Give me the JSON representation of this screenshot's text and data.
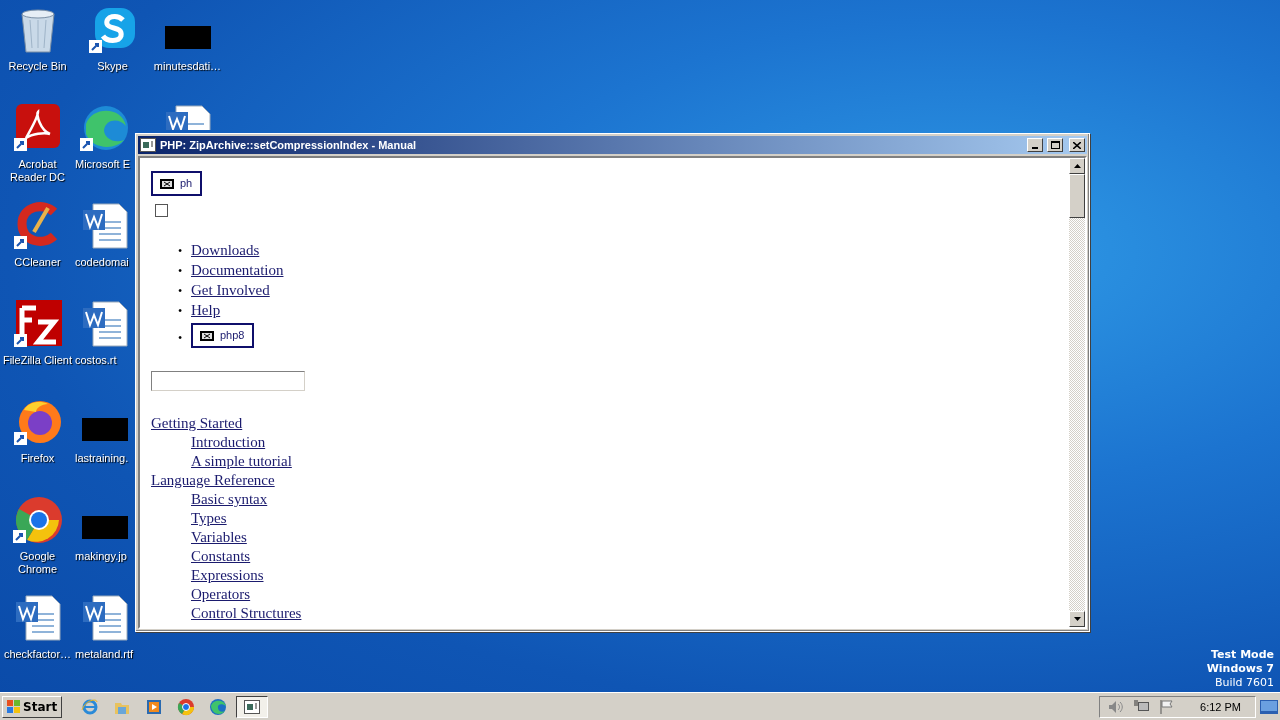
{
  "desktop": {
    "columns": [
      [
        {
          "kind": "recycle",
          "label": "Recycle Bin"
        },
        {
          "kind": "acrobat",
          "label": "Acrobat Reader DC"
        },
        {
          "kind": "ccleaner",
          "label": "CCleaner"
        },
        {
          "kind": "filezilla",
          "label": "FileZilla Client"
        },
        {
          "kind": "firefox",
          "label": "Firefox"
        },
        {
          "kind": "chrome",
          "label": "Google Chrome"
        },
        {
          "kind": "word",
          "label": "checkfactor…"
        }
      ],
      [
        {
          "kind": "skype",
          "label": "Skype"
        },
        {
          "kind": "edge",
          "label": "Microsoft E"
        },
        {
          "kind": "word",
          "label": "codedomai"
        },
        {
          "kind": "word",
          "label": "costos.rt"
        },
        {
          "kind": "redacted",
          "label": "lastraining."
        },
        {
          "kind": "redacted",
          "label": "makingy.jp"
        },
        {
          "kind": "word",
          "label": "metaland.rtf"
        }
      ],
      [
        {
          "kind": "redacted",
          "label": "minutesdati…"
        },
        {
          "kind": "word"
        }
      ]
    ]
  },
  "window": {
    "title": "PHP: ZipArchive::setCompressionIndex - Manual",
    "logo_alt": "ph",
    "checkbox": {
      "checked": false
    },
    "menu_bullet": "•",
    "menu": [
      {
        "kind": "link",
        "label": "Downloads"
      },
      {
        "kind": "link",
        "label": "Documentation"
      },
      {
        "kind": "link",
        "label": "Get Involved"
      },
      {
        "kind": "link",
        "label": "Help"
      },
      {
        "kind": "image",
        "alt": "php8"
      }
    ],
    "nav": [
      {
        "label": "Getting Started",
        "children": [
          {
            "label": "Introduction"
          },
          {
            "label": "A simple tutorial"
          }
        ]
      },
      {
        "label": "Language Reference",
        "children": [
          {
            "label": "Basic syntax"
          },
          {
            "label": "Types"
          },
          {
            "label": "Variables"
          },
          {
            "label": "Constants"
          },
          {
            "label": "Expressions"
          },
          {
            "label": "Operators"
          },
          {
            "label": "Control Structures"
          }
        ]
      }
    ]
  },
  "watermark": [
    "Test Mode",
    "Windows 7",
    "Build 7601"
  ],
  "taskbar": {
    "start": "Start",
    "items": [
      {
        "kind": "ie",
        "selected": false
      },
      {
        "kind": "explorer",
        "selected": false
      },
      {
        "kind": "media",
        "selected": false
      },
      {
        "kind": "chrome",
        "selected": false
      },
      {
        "kind": "edge",
        "selected": false
      },
      {
        "kind": "window",
        "selected": true
      }
    ],
    "clock": "6:12 PM"
  }
}
